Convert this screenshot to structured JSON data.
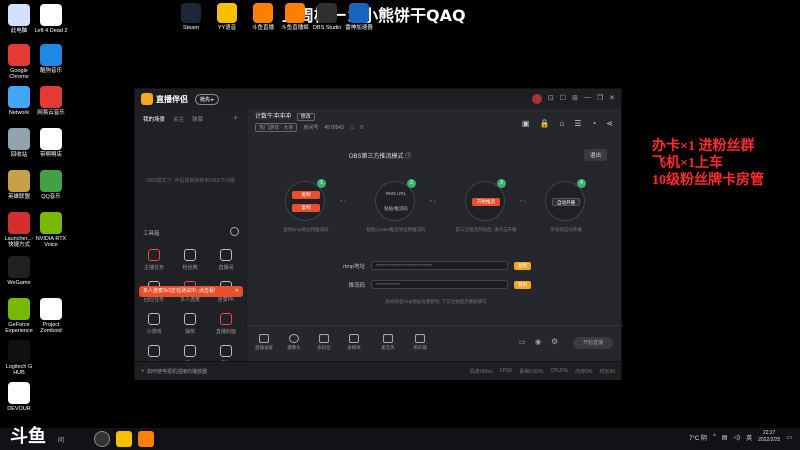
{
  "overlay_title": "上周榜一：小熊饼干QAQ",
  "promo_lines": [
    "办卡×1 进粉丝群",
    "飞机×1上车",
    "10级粉丝牌卡房管"
  ],
  "desktop_icons": [
    {
      "label": "此电脑",
      "color": "#cfe3ff"
    },
    {
      "label": "Left 4 Dead 2",
      "color": "#ffffff"
    },
    {
      "label": "Google Chrome",
      "color": "#e53935"
    },
    {
      "label": "酷狗音乐",
      "color": "#1e88e5"
    },
    {
      "label": "Network",
      "color": "#42a5f5"
    },
    {
      "label": "网易云音乐",
      "color": "#e53935"
    },
    {
      "label": "回收站",
      "color": "#90a4ae"
    },
    {
      "label": "带啊啊店",
      "color": "#ffffff"
    },
    {
      "label": "英雄联盟",
      "color": "#c8a048"
    },
    {
      "label": "QQ音乐",
      "color": "#43a047"
    },
    {
      "label": "Launcher...- 快捷方式",
      "color": "#d32f2f"
    },
    {
      "label": "NVIDIA RTX Voice",
      "color": "#76b900"
    },
    {
      "label": "WeGame",
      "color": "#212121"
    },
    {
      "label": "GeForce Experience",
      "color": "#76b900"
    },
    {
      "label": "Project Zomboid",
      "color": "#ffffff"
    },
    {
      "label": "Logitech G HUB",
      "color": "#111111"
    },
    {
      "label": "DEVOUR",
      "color": "#ffffff"
    }
  ],
  "top_icons": [
    {
      "label": "Steam",
      "color": "#1b2838"
    },
    {
      "label": "YY语音",
      "color": "#f6c000"
    },
    {
      "label": "斗鱼直播",
      "color": "#ff7f00"
    },
    {
      "label": "斗鱼直播姬",
      "color": "#ff7f00"
    },
    {
      "label": "OBS Studio",
      "color": "#302e31"
    },
    {
      "label": "雷神加速器",
      "color": "#1565c0"
    }
  ],
  "app": {
    "title": "直播伴侣",
    "version_badge": "抢先 ▸",
    "window_controls": [
      "⊡",
      "☐",
      "⊞",
      "—",
      "❐",
      "✕"
    ],
    "left_tabs": {
      "tab1": "我的场景",
      "tab2": "关注",
      "tab3": "弹幕",
      "add": "+"
    },
    "empty_text": "OBS模式下, 伴侣场景转移到OBS下问题",
    "toolbox_title": "工具箱",
    "tools": [
      "主播任务",
      "粉丝牌",
      "直播间",
      "回应任务",
      "多人连麦",
      "连麦PK",
      "小游戏",
      "抽奖",
      "直播封面",
      "礼物",
      "互动",
      "更多"
    ],
    "tip_text": "多人连麦3v3正在测试中, 点击看!",
    "tip_close": "✕",
    "room_title": "计数牛冲冲冲",
    "room_tag": "修改",
    "room_category": "热门游戏 · 大杂",
    "room_id_label": "房间号",
    "room_id": "4578943",
    "room_hot": "0",
    "obs_mode_title": "OBS第三方推流模式",
    "exit_label": "退出",
    "steps": [
      {
        "num": "1",
        "btn1": "复制",
        "btn2": "复制",
        "desc": "复制rtmp地址和推流码"
      },
      {
        "num": "2",
        "line1": "RMS URL",
        "line2": "粘贴/推流码",
        "desc": "粘贴入OBS推流地址和推流码"
      },
      {
        "num": "3",
        "btn1": "开始推流",
        "desc": "第三方推流开始后, 请点击开播"
      },
      {
        "num": "4",
        "btn1": "自动开播",
        "desc": "手动或自动开播"
      }
    ],
    "rtmp_label": "rtmp地址",
    "rtmp_value": "********************************",
    "key_label": "推流码",
    "key_value": "**************",
    "copy_label": "复制",
    "hint_text": "房间状态rtmp地址有更新时, 下方也会提示重新填写",
    "bottom_tools": [
      "直播录屏",
      "摄像头",
      "多机位",
      "多媒体",
      "麦克风",
      "扬声器"
    ],
    "live_button": "开始直播",
    "status_msg": "如何使电视机插接的播放器",
    "stats": [
      "码率0Kb/s",
      "FPS0",
      "丢帧0.00%",
      "CPU0%",
      "内存0%",
      "时长00"
    ]
  },
  "taskbar": {
    "logo": "斗鱼",
    "ask": "问",
    "weather": "7°C 阴",
    "lang": "英",
    "time": "22:27",
    "date": "2022/2/25"
  }
}
